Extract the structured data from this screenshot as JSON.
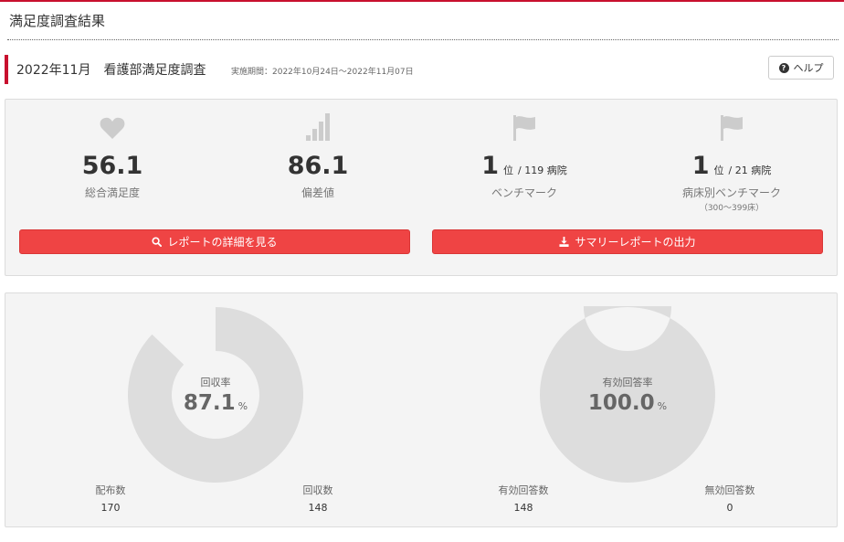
{
  "header": {
    "title": "満足度調査結果"
  },
  "survey": {
    "title": "2022年11月　看護部満足度調査",
    "period": "実施期間：2022年10月24日～2022年11月07日"
  },
  "help": {
    "label": "ヘルプ",
    "icon": "question-circle-icon"
  },
  "stats": [
    {
      "icon": "heart-icon",
      "value": "56.1",
      "label": "総合満足度"
    },
    {
      "icon": "signal-bars-icon",
      "value": "86.1",
      "label": "偏差値"
    },
    {
      "icon": "flag-icon",
      "rank": "1",
      "rank_unit": "位",
      "total": "/ 119 病院",
      "label": "ベンチマーク"
    },
    {
      "icon": "flag-icon",
      "rank": "1",
      "rank_unit": "位",
      "total": "/ 21 病院",
      "label": "病床別ベンチマーク",
      "note": "（300～399床）"
    }
  ],
  "buttons": {
    "detail_report": {
      "label": "レポートの詳細を見る",
      "icon": "search-icon"
    },
    "summary_report": {
      "label": "サマリーレポートの出力",
      "icon": "download-icon"
    }
  },
  "charts": {
    "response_rate": {
      "label": "回収率",
      "value": "87.1",
      "unit": "%",
      "ratio": 0.871,
      "left_label": "配布数",
      "left_value": "170",
      "right_label": "回収数",
      "right_value": "148"
    },
    "valid_rate": {
      "label": "有効回答率",
      "value": "100.0",
      "unit": "%",
      "ratio": 1.0,
      "left_label": "有効回答数",
      "left_value": "148",
      "right_label": "無効回答数",
      "right_value": "0"
    }
  },
  "colors": {
    "accent": "#c8102e",
    "button": "#ef4444",
    "icon_gray": "#cccccc",
    "donut_gray": "#dddddd"
  }
}
